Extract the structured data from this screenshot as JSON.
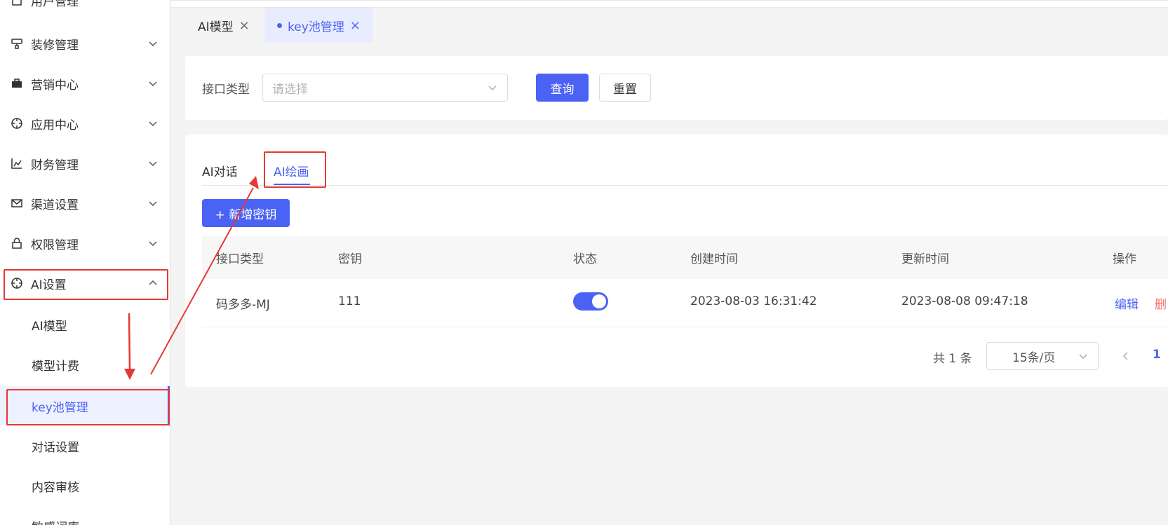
{
  "sidebar": {
    "partial_top_item": "用户管理",
    "items": [
      {
        "label": "装修管理",
        "icon": "brush-icon"
      },
      {
        "label": "营销中心",
        "icon": "briefcase-icon"
      },
      {
        "label": "应用中心",
        "icon": "compass-icon"
      },
      {
        "label": "财务管理",
        "icon": "chart-icon"
      },
      {
        "label": "渠道设置",
        "icon": "mail-icon"
      },
      {
        "label": "权限管理",
        "icon": "lock-icon"
      },
      {
        "label": "AI设置",
        "icon": "target-icon"
      }
    ],
    "sub_items": [
      {
        "label": "AI模型"
      },
      {
        "label": "模型计费"
      },
      {
        "label": "key池管理"
      },
      {
        "label": "对话设置"
      },
      {
        "label": "内容审核"
      },
      {
        "label": "敏感词库"
      }
    ]
  },
  "page_tabs": [
    {
      "label": "AI模型"
    },
    {
      "label": "key池管理"
    }
  ],
  "filter": {
    "label": "接口类型",
    "select_placeholder": "请选择",
    "query_button": "查询",
    "reset_button": "重置"
  },
  "content_tabs": [
    {
      "label": "AI对话"
    },
    {
      "label": "AI绘画"
    }
  ],
  "add_button": "+ 新增密钥",
  "table": {
    "headers": [
      "接口类型",
      "密钥",
      "状态",
      "创建时间",
      "更新时间",
      "操作"
    ],
    "rows": [
      {
        "type": "码多多-MJ",
        "key": "111",
        "status_on": true,
        "created": "2023-08-03 16:31:42",
        "updated": "2023-08-08 09:47:18",
        "edit": "编辑",
        "delete": "删"
      }
    ]
  },
  "pagination": {
    "total": "共 1 条",
    "page_size": "15条/页",
    "current_page": "1",
    "prev_icon": "chevron-left-icon"
  },
  "colors": {
    "accent": "#4a63f5",
    "annotation": "#e53935",
    "delete": "#f56c6c"
  }
}
